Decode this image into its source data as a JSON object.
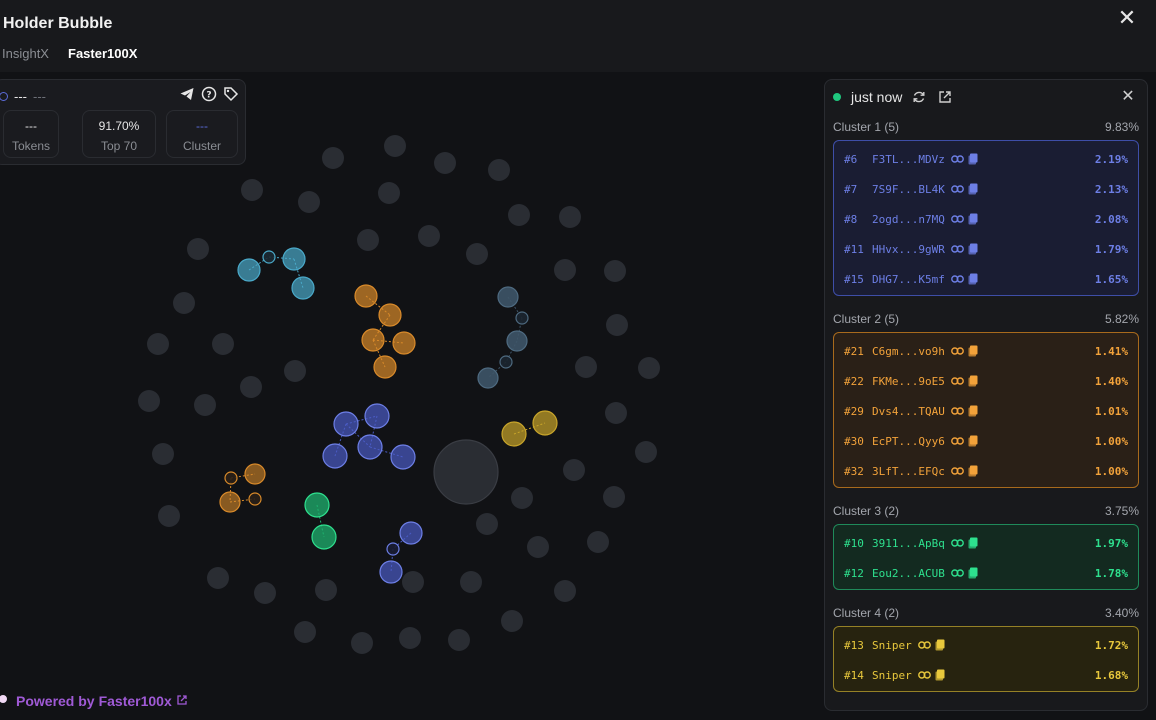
{
  "header": {
    "title": "Holder Bubble",
    "tabs": [
      "InsightX",
      "Faster100X"
    ]
  },
  "stats": {
    "head_primary": "---",
    "head_secondary": "---",
    "boxes": [
      {
        "value": "---",
        "label": "Tokens"
      },
      {
        "value": "91.70%",
        "label": "Top 70"
      },
      {
        "value": "---",
        "label": "Cluster"
      }
    ],
    "icons": [
      "telegram-icon",
      "help-icon",
      "tag-icon"
    ]
  },
  "powered": {
    "prefix": "Powered by",
    "brand": "Faster100x"
  },
  "panel": {
    "status": "just now",
    "clusters": [
      {
        "title": "Cluster 1 (5)",
        "pct": "9.83%",
        "color": "#6d7fe6",
        "rows": [
          {
            "rank": "#6",
            "addr": "F3TL...MDVz",
            "pct": "2.19%"
          },
          {
            "rank": "#7",
            "addr": "7S9F...BL4K",
            "pct": "2.13%"
          },
          {
            "rank": "#8",
            "addr": "2ogd...n7MQ",
            "pct": "2.08%"
          },
          {
            "rank": "#11",
            "addr": "HHvx...9gWR",
            "pct": "1.79%"
          },
          {
            "rank": "#15",
            "addr": "DHG7...K5mf",
            "pct": "1.65%"
          }
        ]
      },
      {
        "title": "Cluster 2 (5)",
        "pct": "5.82%",
        "color": "#f2a23a",
        "rows": [
          {
            "rank": "#21",
            "addr": "C6gm...vo9h",
            "pct": "1.41%"
          },
          {
            "rank": "#22",
            "addr": "FKMe...9oE5",
            "pct": "1.40%"
          },
          {
            "rank": "#29",
            "addr": "Dvs4...TQAU",
            "pct": "1.01%"
          },
          {
            "rank": "#30",
            "addr": "EcPT...Qyy6",
            "pct": "1.00%"
          },
          {
            "rank": "#32",
            "addr": "3LfT...EFQc",
            "pct": "1.00%"
          }
        ]
      },
      {
        "title": "Cluster 3 (2)",
        "pct": "3.75%",
        "color": "#2ee08e",
        "rows": [
          {
            "rank": "#10",
            "addr": "3911...ApBq",
            "pct": "1.97%"
          },
          {
            "rank": "#12",
            "addr": "Eou2...ACUB",
            "pct": "1.78%"
          }
        ]
      },
      {
        "title": "Cluster 4 (2)",
        "pct": "3.40%",
        "color": "#e8c83c",
        "rows": [
          {
            "rank": "#13",
            "addr": "Sniper",
            "pct": "1.72%"
          },
          {
            "rank": "#14",
            "addr": "Sniper",
            "pct": "1.68%"
          }
        ]
      }
    ]
  },
  "colors": {
    "bg": "#111215",
    "bubble_gray": "#2a2d33",
    "cyan": "#4aa9c9",
    "orange": "#d98a2a",
    "blue": "#4a5bc4",
    "green": "#1fb26f",
    "yellow": "#c9a52a",
    "slate": "#3e5568"
  }
}
